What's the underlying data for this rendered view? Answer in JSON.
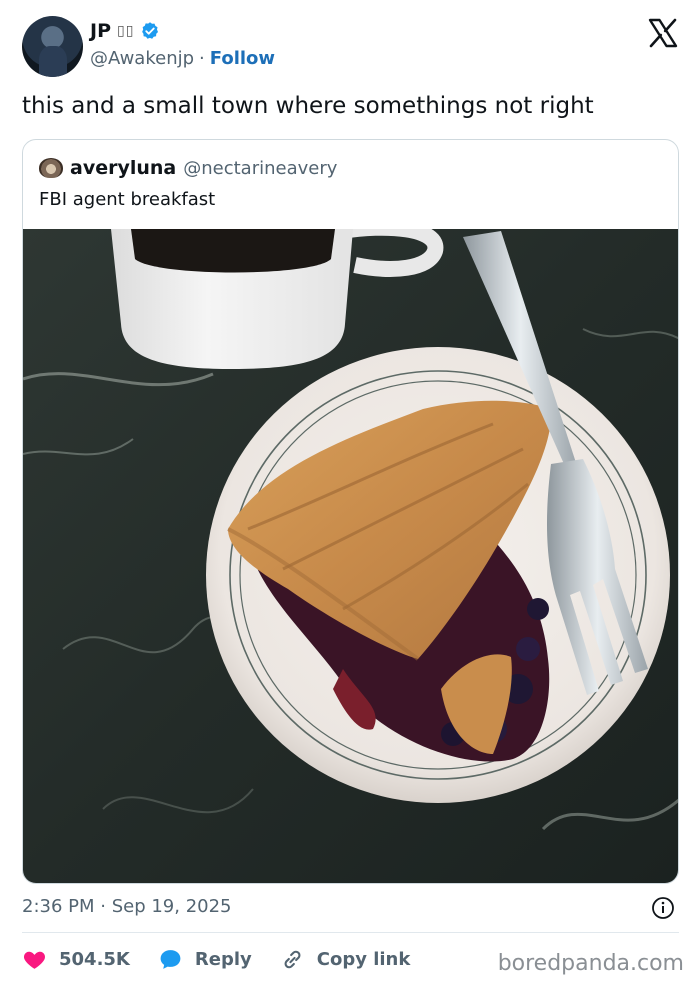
{
  "author": {
    "name": "JP",
    "flags": "▯▯",
    "handle": "@Awakenjp",
    "separator": "·",
    "follow_label": "Follow"
  },
  "tweet": {
    "text": "this and a small town where somethings not right"
  },
  "quoted": {
    "name": "averyluna",
    "handle": "@nectarineavery",
    "text": "FBI agent breakfast"
  },
  "meta": {
    "timestamp": "2:36 PM · Sep 19, 2025"
  },
  "actions": {
    "likes": "504.5K",
    "reply_label": "Reply",
    "copy_label": "Copy link"
  },
  "watermark": "boredpanda.com",
  "colors": {
    "accent": "#1d9bf0",
    "like": "#f91880",
    "muted": "#536471"
  },
  "icons": [
    "verified-badge-icon",
    "x-logo-icon",
    "info-icon",
    "heart-icon",
    "reply-bubble-icon",
    "link-icon"
  ]
}
